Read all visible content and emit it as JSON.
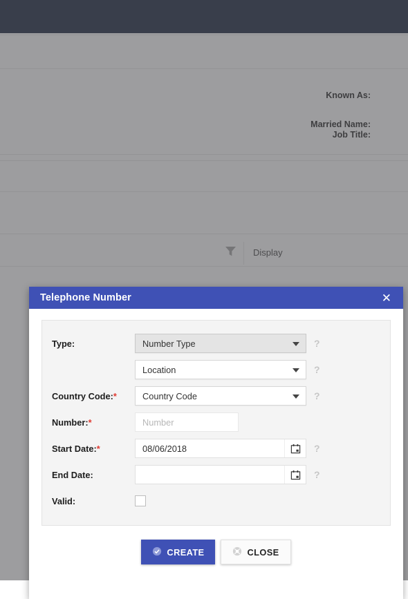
{
  "background": {
    "topbar": {
      "color": "#101d35"
    },
    "detail_labels": [
      "Known As:",
      "Married Name:",
      "Job Title:"
    ],
    "toolbar": {
      "filter_icon": "filter-funnel-icon",
      "display_label": "Display"
    }
  },
  "dialog": {
    "title": "Telephone Number",
    "close_icon": "close-x-icon",
    "header_color": "#3f51b5",
    "fields": [
      {
        "label": "Type:",
        "required": false,
        "control": "select",
        "value": "Number Type",
        "hovered": true,
        "help": "?"
      },
      {
        "label": "",
        "required": false,
        "control": "select",
        "value": "Location",
        "hovered": false,
        "help": "?"
      },
      {
        "label": "Country Code:",
        "required": true,
        "control": "select",
        "value": "Country Code",
        "hovered": false,
        "help": "?"
      },
      {
        "label": "Number:",
        "required": true,
        "control": "text",
        "value": "",
        "placeholder": "Number",
        "help": ""
      },
      {
        "label": "Start Date:",
        "required": true,
        "control": "date",
        "value": "08/06/2018",
        "icon": "calendar-icon",
        "help": "?"
      },
      {
        "label": "End Date:",
        "required": false,
        "control": "date",
        "value": "",
        "icon": "calendar-icon",
        "help": "?"
      },
      {
        "label": "Valid:",
        "required": false,
        "control": "checkbox",
        "checked": false,
        "help": ""
      }
    ],
    "buttons": {
      "create": {
        "label": "CREATE",
        "icon": "check-circle-icon"
      },
      "close": {
        "label": "CLOSE",
        "icon": "cancel-circle-icon"
      }
    }
  }
}
